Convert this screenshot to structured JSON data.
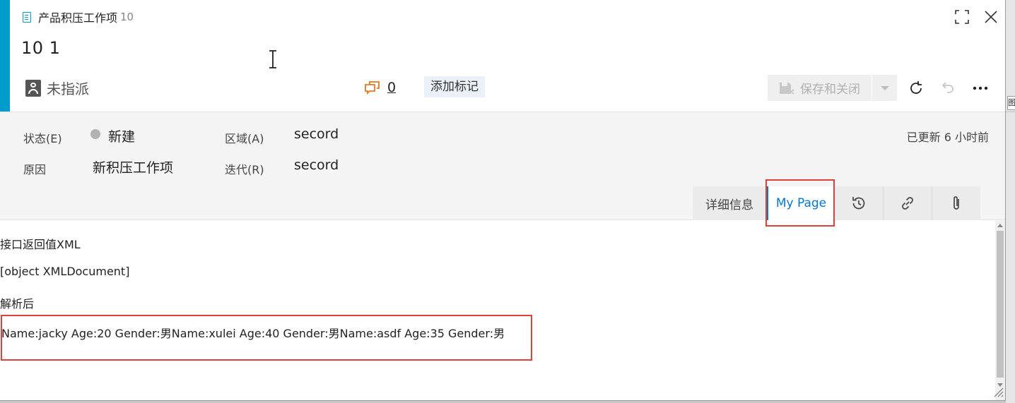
{
  "work_item": {
    "type_label": "产品积压工作项",
    "id": "10",
    "title": "10   1"
  },
  "header": {
    "assignee": "未指派",
    "discussion_count": "0",
    "add_tag_label": "添加标记",
    "save_label": "保存和关闭"
  },
  "fields": {
    "state_label": "状态(E)",
    "state_value": "新建",
    "reason_label": "原因",
    "reason_value": "新积压工作项",
    "area_label": "区域(A)",
    "area_value": "secord",
    "iteration_label": "迭代(R)",
    "iteration_value": "secord",
    "updated": "已更新 6 小时前"
  },
  "tabs": {
    "details": "详细信息",
    "my_page": "My Page"
  },
  "content": {
    "line1": "接口返回值XML",
    "line2": "[object XMLDocument]",
    "line3": "解析后",
    "line4": "Name:jacky Age:20 Gender:男Name:xulei Age:40 Gender:男Name:asdf Age:35 Gender:男"
  },
  "colors": {
    "accent": "#009ccc",
    "active_tab": "#0078d4",
    "highlight": "#e0403c",
    "discussion_icon": "#e87722"
  },
  "icons": [
    "work-item-type-icon",
    "fullscreen-icon",
    "close-icon",
    "assignee-avatar-icon",
    "discussion-icon",
    "save-icon",
    "dropdown-chevron-icon",
    "refresh-icon",
    "undo-icon",
    "more-icon",
    "history-icon",
    "link-icon",
    "attachment-icon"
  ],
  "right_edge_fragment": "图"
}
